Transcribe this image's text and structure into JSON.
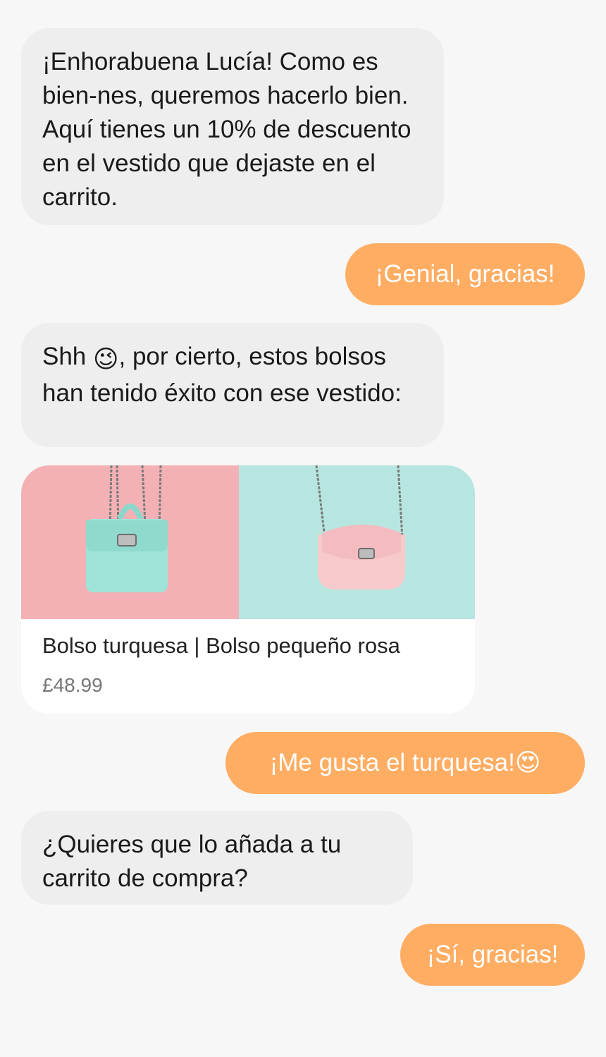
{
  "messages": {
    "bot1": "¡Enhorabuena Lucía! Como es bien-nes, queremos hacerlo bien. Aquí tienes un 10% de descuento en el vestido que dejaste en el carrito.",
    "user1": "¡Genial, gracias!",
    "bot2_before": "Shh ",
    "bot2_after": ", por cierto, estos bolsos han tenido éxito con ese vestido:",
    "user2": "¡Me gusta el turquesa! ",
    "bot3": "¿Quieres que lo añada a tu carrito de compra?",
    "user3": "¡Sí, gracias!"
  },
  "emojis": {
    "wink": "😉",
    "heart_eyes": "😍"
  },
  "product_card": {
    "title": "Bolso turquesa | Bolso pequeño rosa",
    "price": "£48.99",
    "images": [
      {
        "name": "turquoise-bag-image",
        "bag_color": "#9fe3d8",
        "background": "#f3b1b5"
      },
      {
        "name": "pink-bag-image",
        "bag_color": "#f7c9cb",
        "background": "#b7e6e0"
      }
    ]
  },
  "colors": {
    "user_bubble": "#ffad63",
    "bot_bubble": "#eeeeee",
    "page_background": "#f7f7f7"
  }
}
